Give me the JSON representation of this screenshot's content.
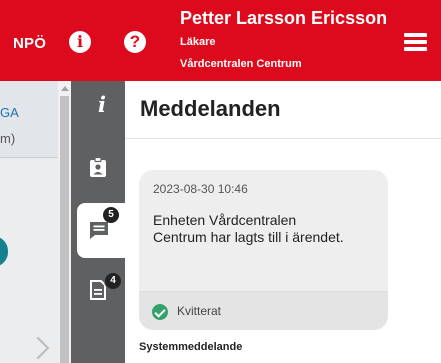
{
  "header": {
    "brand": "NPÖ",
    "user": {
      "name": "Petter Larsson Ericsson",
      "role": "Läkare",
      "unit": "Vårdcentralen Centrum"
    },
    "icons": [
      "info-icon",
      "help-icon",
      "menu-icon"
    ]
  },
  "left_page": {
    "text_line_1": "GA",
    "text_line_2": "m)"
  },
  "tabbar": {
    "tabs": [
      {
        "icon": "info-icon",
        "glyph": "i"
      },
      {
        "icon": "patient-badge-icon"
      },
      {
        "icon": "messages-icon",
        "badge": "5",
        "active": true
      },
      {
        "icon": "document-icon",
        "badge": "4"
      }
    ]
  },
  "panel": {
    "title": "Meddelanden",
    "messages": [
      {
        "timestamp": "2023-08-30 10:46",
        "text": "Enheten Vårdcentralen Centrum har lagts till i ärendet.",
        "status": "Kvitterat",
        "sender": "Systemmeddelande"
      }
    ]
  },
  "colors": {
    "header_red": "#dc0a1c",
    "tabbar_gray": "#5f6061",
    "ack_green": "#36a26b",
    "teal": "#14818d"
  }
}
